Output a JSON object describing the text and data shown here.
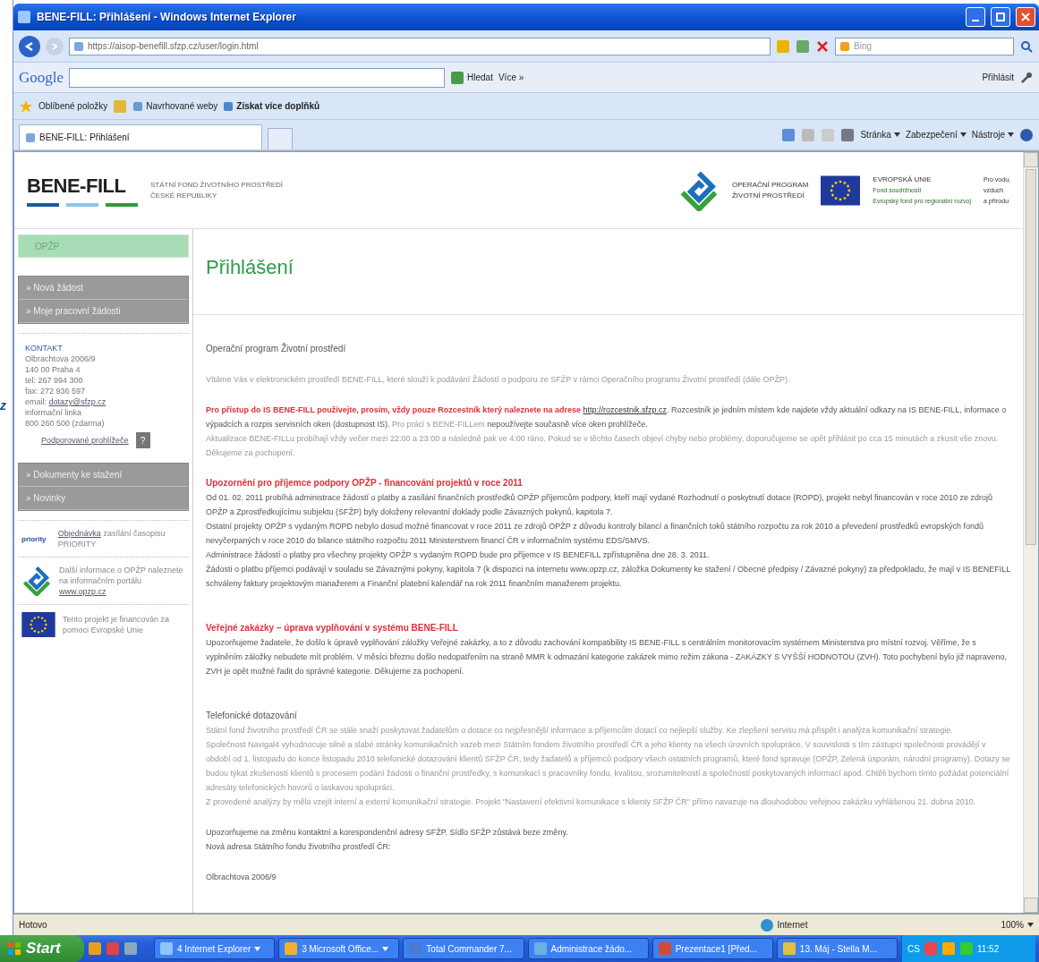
{
  "window": {
    "title": "BENE-FILL: Přihlášení - Windows Internet Explorer"
  },
  "address_bar": {
    "url": "https://aisop-benefill.sfzp.cz/user/login.html",
    "search_placeholder": "Bing"
  },
  "google_toolbar": {
    "logo": "Google",
    "search": "Hledat",
    "more": "Více »",
    "sign_in": "Přihlásit"
  },
  "favorites_bar": {
    "label": "Oblíbené položky",
    "items": [
      {
        "kind": "folder",
        "label": "Navrhované weby"
      },
      {
        "kind": "addons",
        "label": "Získat více doplňků"
      }
    ]
  },
  "tabs": [
    {
      "label": "BENE-FILL: Přihlášení",
      "selected": true
    }
  ],
  "command_bar": [
    "Stránka",
    "Zabezpečení",
    "Nástroje"
  ],
  "margin_mark": "z",
  "header": {
    "logo": "BENE-FILL",
    "org": [
      "STÁTNÍ FOND ŽIVOTNÍHO PROSTŘEDÍ",
      "ČESKÉ REPUBLIKY"
    ],
    "program": [
      "OPERAČNÍ PROGRAM",
      "ŽIVOTNÍ PROSTŘEDÍ"
    ],
    "eu": {
      "title": "EVROPSKÁ UNIE",
      "lines": [
        "Fond soudržnosti",
        "Evropský fond pro regionální rozvoj"
      ]
    },
    "motto": [
      "Pro vodu,",
      "vzduch",
      "a přírodu"
    ]
  },
  "sidebar": {
    "program": "OPŽP",
    "menu_top": [
      "» Nová žádost",
      "» Moje pracovní žádosti"
    ],
    "contact": {
      "heading": "KONTAKT",
      "lines": [
        {
          "text": "Olbrachtova 2006/9"
        },
        {
          "text": "140 00 Praha 4"
        },
        {
          "text": "tel: 267 994 300"
        },
        {
          "text": "fax: 272 936 597"
        },
        {
          "text": "email: ",
          "link": "dotazy@sfzp.cz"
        },
        {
          "text": "informační linka"
        },
        {
          "text": "800 260 500 (zdarma)"
        }
      ],
      "browsers": "Podporované prohlížeče",
      "help": "?"
    },
    "menu_bottom": [
      "» Dokumenty ke stažení",
      "» Novinky"
    ],
    "promos": [
      {
        "kind": "priority",
        "logo": "priority",
        "link": "Objednávka",
        "text": " zasílání časopisu PRIORITY"
      },
      {
        "kind": "opzp",
        "text": "Další informace o OPŽP naleznete na informačním portálu ",
        "link": "www.opzp.cz"
      },
      {
        "kind": "eu",
        "text": "Tento projekt je financován za pomoci Evropské Unie"
      }
    ]
  },
  "main": {
    "title": "Přihlášení",
    "sections": [
      {
        "blocks": [
          {
            "kind": "lead",
            "text": "Operační program Životní prostředí"
          }
        ]
      },
      {
        "blocks": [
          {
            "kind": "muted",
            "text": "Vítáme Vás v elektronickém prostředí BENE-FILL, které slouží k podávání Žádostí o podporu ze SFŽP v rámci Operačního programu Životní prostředí (dále OPŽP)."
          }
        ]
      },
      {
        "blocks": [
          {
            "kind": "mixed",
            "segments": [
              {
                "kind": "alert",
                "text": "Pro přístup do IS BENE-FILL používejte, prosím, vždy pouze Rozcestník který naleznete na adrese "
              },
              {
                "kind": "link",
                "text": "http://rozcestnik.sfzp.cz"
              },
              {
                "kind": "body",
                "text": ". Rozcestník je jedním místem kde najdete vždy aktuální odkazy na IS BENE-FILL, informace o výpadcích a rozpis servisních oken (dostupnost IS). "
              },
              {
                "kind": "muted",
                "text": "Pro práci s BENE-FILLem "
              },
              {
                "kind": "body",
                "text": "nepoužívejte současně více oken prohlížeče."
              }
            ]
          },
          {
            "kind": "muted",
            "text": "Aktualizace BENE-FILLu probíhají vždy večer mezi 22:00 a 23:00 a následně pak ve 4:00 ráno. Pokud se v těchto časech objeví chyby nebo problémy, doporučujeme se opět přihlásit po cca 15 minutách a zkusit vše znovu. Děkujeme za pochopení."
          }
        ]
      },
      {
        "blocks": [
          {
            "kind": "heading",
            "text": "Upozornění pro příjemce podpory OPŽP - financování projektů v roce 2011"
          },
          {
            "kind": "body",
            "text": "Od 01. 02. 2011 probíhá administrace žádostí o platby a zasílání finančních prostředků OPŽP příjemcům podpory, kteří mají vydané Rozhodnutí o poskytnutí dotace (ROPD), projekt nebyl financován v roce 2010 ze zdrojů OPŽP a Zprostředkujícímu subjektu (SFŽP) byly doloženy relevantní doklady podle Závazných pokynů, kapitola 7."
          },
          {
            "kind": "body",
            "text": "Ostatní projekty OPŽP s vydaným ROPD nebylo dosud možné financovat v roce 2011 ze zdrojů OPŽP z důvodu kontroly bilancí a finančních toků státního rozpočtu za rok 2010 a převedení prostředků evropských fondů nevyčerpaných v roce 2010 do bilance státního rozpočtu 2011 Ministerstvem financí ČR v informačním systému EDS/SMVS."
          },
          {
            "kind": "body",
            "text": "Administrace žádostí o platby pro všechny projekty OPŽP s vydaným ROPD bude pro příjemce v IS BENEFILL zpřístupněna dne 28. 3. 2011."
          },
          {
            "kind": "body",
            "text": "Žádosti o platbu příjemci podávají v souladu se Závaznými pokyny, kapitola 7 (k dispozici na internetu www.opzp.cz, záložka Dokumenty ke stažení / Obecné předpisy / Závazné pokyny) za předpokladu, že mají v IS BENEFILL schváleny faktury projektovým manažerem a Finanční platební kalendář na rok 2011 finančním manažerem projektu."
          }
        ]
      },
      {
        "blocks": [
          {
            "kind": "heading",
            "text": "Veřejné zakázky – úprava vyplňování v systému BENE-FILL"
          },
          {
            "kind": "body",
            "text": "Upozorňujeme žadatele, že došlo k úpravě vyplňování záložky Veřejné zakázky, a to z důvodu zachování kompatibility IS BENE-FILL s centrálním monitorovacím systémem Ministerstva pro místní rozvoj. Věříme, že s vyplněním záložky nebudete mít problém. V měsíci březnu došlo nedopatřením na straně MMR k odmazání kategorie zakázek mimo režim zákona - ZAKÁZKY S VYŠŠÍ HODNOTOU (ZVH). Toto pochybení bylo již napraveno, ZVH je opět možné řadit do správné kategorie. Děkujeme za pochopení."
          }
        ]
      },
      {
        "blocks": [
          {
            "kind": "lead",
            "text": "Telefonické dotazování"
          },
          {
            "kind": "muted",
            "text": "Státní fond životního prostředí ČR se stále snaží poskytovat žadatelům o dotace co nejpřesnější informace a příjemcům dotací co nejlepší služby. Ke zlepšení servisu má přispět i analýza komunikační strategie."
          },
          {
            "kind": "muted",
            "text": "Společnost Navigal4 vyhodnocuje silné a slabé stránky komunikačních vazeb mezi Státním fondem životního prostředí ČR a jeho klienty na všech úrovních spolupráce. V souvislosti s tím zástupci společnosti provádějí v období od 1. listopadu do konce listopadu 2010 telefonické dotazování klientů SFŽP ČR, tedy žadatelů a příjemců podpory všech ostatních programů, které fond spravuje (OPŽP, Zelená úsporám, národní programy). Dotazy se budou týkat zkušeností klientů s procesem podání žádosti o finanční prostředky, s komunikací s pracovníky fondu, kvalitou, srozumitelností a společností poskytovaných informací apod. Chtěli bychom tímto požádat potenciální adresáty telefonických hovorů o laskavou spolupráci."
          },
          {
            "kind": "muted",
            "text": "Z provedené analýzy by měla vzejít interní a externí komunikační strategie. Projekt \"Nastavení efektivní komunikace s klienty SFŽP ČR\" přímo navazuje na dlouhodobou veřejnou zakázku vyhlášenou 21. dubna 2010."
          }
        ]
      },
      {
        "blocks": [
          {
            "kind": "body",
            "text": "Upozorňujeme na změnu kontaktní a korespondenční adresy SFŽP. Sídlo SFŽP zůstává beze změny."
          },
          {
            "kind": "body",
            "text": "Nová adresa Státního fondu životního prostředí ČR:"
          }
        ]
      },
      {
        "blocks": [
          {
            "kind": "body",
            "text": "Olbrachtova 2006/9"
          }
        ]
      }
    ]
  },
  "status_bar": {
    "status": "Hotovo",
    "zone": "Internet",
    "zoom": "100%"
  },
  "taskbar": {
    "start": "Start",
    "items": [
      {
        "label": "4 Internet Explorer",
        "group": true
      },
      {
        "label": "3 Microsoft Office...",
        "group": true
      },
      {
        "label": "Total Commander 7...",
        "group": false
      },
      {
        "label": "Administrace žádo...",
        "group": false
      },
      {
        "label": "Prezentace1 [Před...",
        "group": false
      },
      {
        "label": "13. Máj - Stella M...",
        "group": false
      }
    ],
    "language": "CS",
    "clock": "11:52"
  }
}
